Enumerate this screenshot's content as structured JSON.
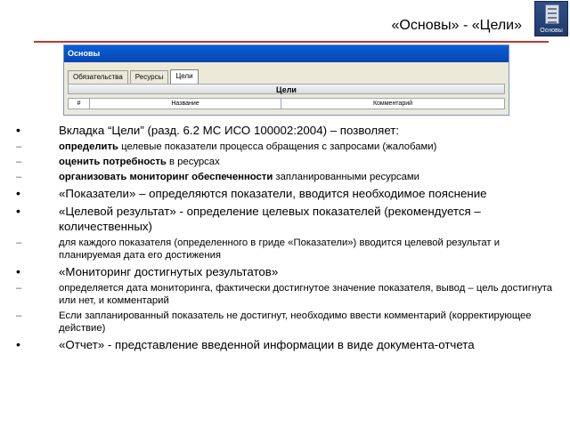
{
  "slide": {
    "title": "«Основы» - «Цели»"
  },
  "logo": {
    "label": "Основы"
  },
  "embedded_window": {
    "title": "Основы",
    "tabs": [
      "Обязательства",
      "Ресурсы",
      "Цели"
    ],
    "active_tab": "Цели",
    "section_header": "Цели",
    "columns": [
      "#",
      "Название",
      "Комментарий"
    ]
  },
  "bullets": [
    {
      "level": 1,
      "text": "Вкладка “Цели” (разд. 6.2 МС ИСО 100002:2004) – позволяет:"
    },
    {
      "level": 2,
      "bold": "определить",
      "text": " целевые показатели процесса  обращения с запросами (жалобами)"
    },
    {
      "level": 2,
      "bold": "оценить потребность",
      "text": " в ресурсах"
    },
    {
      "level": 2,
      "bold": "организовать мониторинг обеспеченности",
      "text": " запланированными ресурсами"
    },
    {
      "level": 1,
      "text": "«Показатели» – определяются показатели, вводится необходимое пояснение"
    },
    {
      "level": 1,
      "text": "«Целевой результат» - определение целевых показателей (рекомендуется – количественных)"
    },
    {
      "level": 2,
      "text": "для каждого показателя  (определенного в гриде «Показатели») вводится целевой результат и планируемая дата его достижения"
    },
    {
      "level": 1,
      "text": "«Мониторинг достигнутых результатов»"
    },
    {
      "level": 2,
      "text": "определяется дата мониторинга, фактически достигнутое значение показателя, вывод – цель достигнута или нет, и комментарий"
    },
    {
      "level": 2,
      "text": "Если запланированный показатель не достигнут, необходимо ввести комментарий (корректирующее действие)"
    },
    {
      "level": 1,
      "text": "«Отчет» - представление введенной информации в виде документа-отчета"
    }
  ],
  "colors": {
    "title_rule": "#c0392b",
    "window_titlebar": "#0a5fd6",
    "window_face": "#ece9d8"
  }
}
